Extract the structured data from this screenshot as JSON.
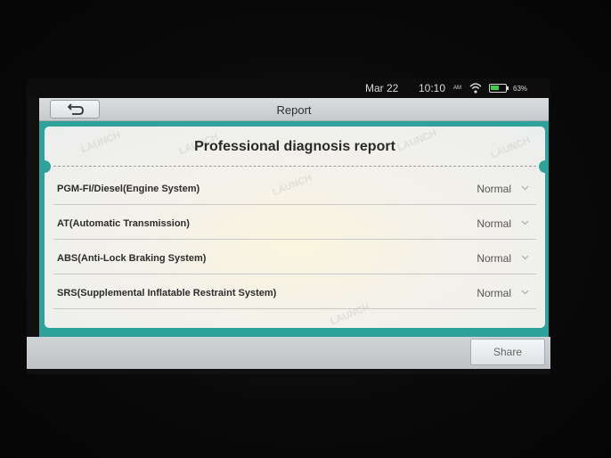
{
  "status_bar": {
    "date": "Mar 22",
    "time": "10:10",
    "ampm": "AM",
    "battery_percent": "63%",
    "battery_level": 0.63,
    "icons": [
      "wifi-icon",
      "battery-icon"
    ]
  },
  "header": {
    "title": "Report",
    "back_icon": "back-arrow-icon"
  },
  "report": {
    "heading": "Professional diagnosis report",
    "watermark": "LAUNCH",
    "systems": [
      {
        "name": "PGM-FI/Diesel(Engine System)",
        "status": "Normal"
      },
      {
        "name": "AT(Automatic Transmission)",
        "status": "Normal"
      },
      {
        "name": "ABS(Anti-Lock Braking System)",
        "status": "Normal"
      },
      {
        "name": "SRS(Supplemental Inflatable Restraint System)",
        "status": "Normal"
      }
    ]
  },
  "footer": {
    "share_label": "Share"
  },
  "colors": {
    "accent": "#2ea29b",
    "battery": "#3ed04a"
  }
}
